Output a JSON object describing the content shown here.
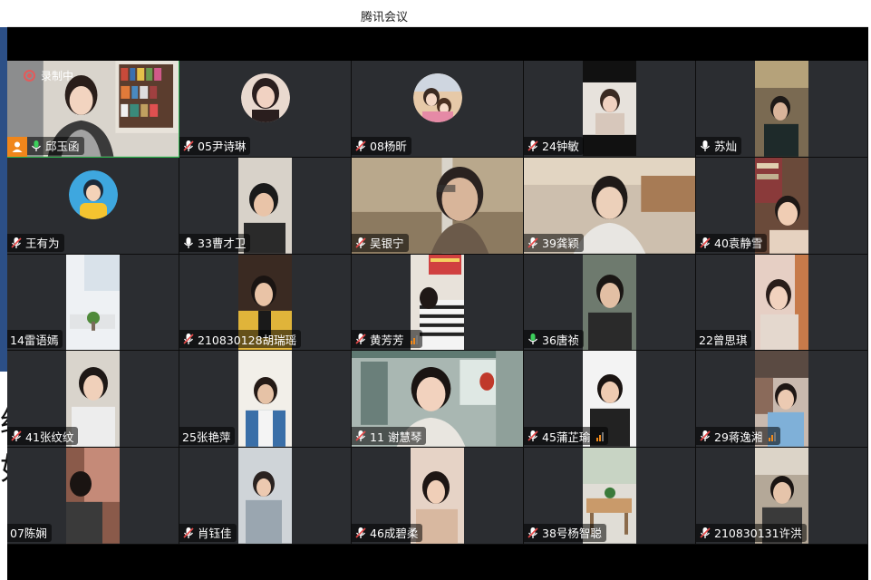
{
  "window": {
    "title": "腾讯会议"
  },
  "recording": {
    "label": "录制中"
  },
  "edge": {
    "c1": "绍",
    "c2": "如"
  },
  "colors": {
    "accent_active": "#2bb24c",
    "host_badge": "#f0861b",
    "tile_bg": "#2b2d31"
  },
  "participants": [
    {
      "name": "邱玉函",
      "mic": "mic-active-icon",
      "host": true,
      "active": true
    },
    {
      "name": "05尹诗琳",
      "mic": "mic-muted-icon"
    },
    {
      "name": "08杨昕",
      "mic": "mic-muted-icon"
    },
    {
      "name": "24钟敏",
      "mic": "mic-muted-icon"
    },
    {
      "name": "苏灿",
      "mic": "mic-on-icon"
    },
    {
      "name": "王有为",
      "mic": "mic-muted-icon"
    },
    {
      "name": "33曹才卫",
      "mic": "mic-on-icon"
    },
    {
      "name": "吴银宁",
      "mic": "mic-muted-icon"
    },
    {
      "name": "39龚颖",
      "mic": "mic-muted-icon"
    },
    {
      "name": "40袁静雪",
      "mic": "mic-muted-icon"
    },
    {
      "name": "14雷语嫣",
      "mic": "none"
    },
    {
      "name": "210830128胡瑞瑶",
      "mic": "mic-muted-icon"
    },
    {
      "name": "黄芳芳",
      "mic": "mic-muted-icon",
      "signal": true
    },
    {
      "name": "36唐祯",
      "mic": "mic-active-icon"
    },
    {
      "name": "22曾思琪",
      "mic": "none"
    },
    {
      "name": "41张纹纹",
      "mic": "mic-muted-icon"
    },
    {
      "name": "25张艳萍",
      "mic": "none"
    },
    {
      "name": "11 谢慧琴",
      "mic": "mic-muted-icon"
    },
    {
      "name": "45蒲芷瑜",
      "mic": "mic-muted-icon",
      "signal": true
    },
    {
      "name": "29蒋逸湘",
      "mic": "mic-muted-icon",
      "signal": true
    },
    {
      "name": "07陈娴",
      "mic": "none"
    },
    {
      "name": "肖钰佳",
      "mic": "mic-muted-icon"
    },
    {
      "name": "46成碧柔",
      "mic": "mic-muted-icon"
    },
    {
      "name": "38号杨智聪",
      "mic": "mic-muted-icon"
    },
    {
      "name": "210830131许洪",
      "mic": "mic-muted-icon"
    }
  ]
}
